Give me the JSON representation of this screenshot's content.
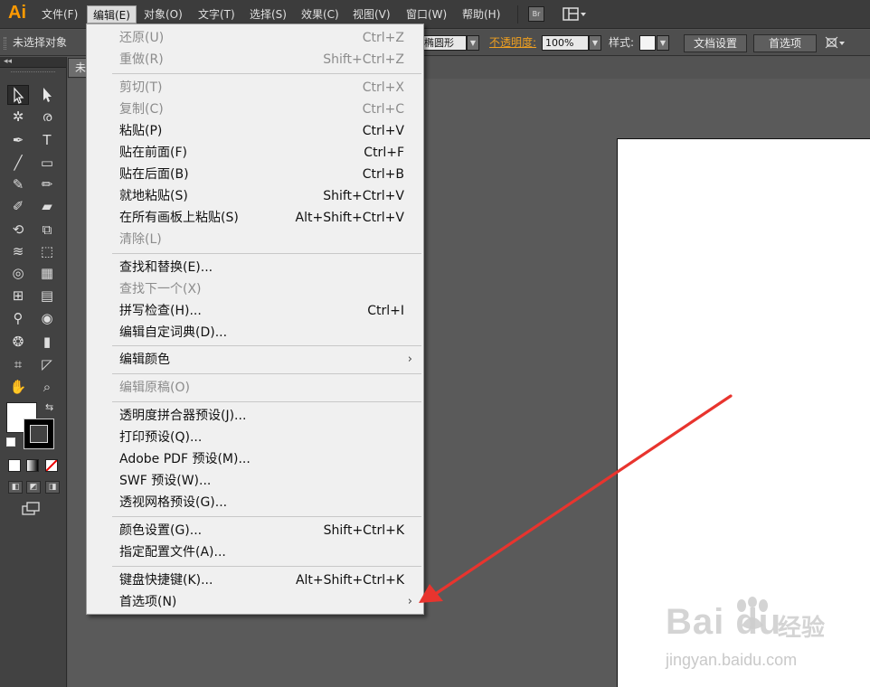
{
  "app": {
    "logo": "Ai",
    "accent": "#ff9a00"
  },
  "menubar": {
    "items": [
      "文件(F)",
      "编辑(E)",
      "对象(O)",
      "文字(T)",
      "选择(S)",
      "效果(C)",
      "视图(V)",
      "窗口(W)",
      "帮助(H)"
    ],
    "active": "编辑(E)",
    "bridge_label": "Br"
  },
  "controlbar": {
    "selection_status": "未选择对象",
    "shape_field": "椭圆形",
    "opacity_label": "不透明度:",
    "opacity_value": "100%",
    "style_label": "样式:",
    "doc_setup_button": "文档设置",
    "preferences_button": "首选项",
    "opacity_color": "#f0a020"
  },
  "document_tab": {
    "label": "未"
  },
  "tools_panel": {
    "collapse_glyph": "◂◂"
  },
  "edit_menu": {
    "items": [
      {
        "label": "还原(U)",
        "shortcut": "Ctrl+Z",
        "disabled": true
      },
      {
        "label": "重做(R)",
        "shortcut": "Shift+Ctrl+Z",
        "disabled": true
      },
      {
        "label": "剪切(T)",
        "shortcut": "Ctrl+X",
        "disabled": true
      },
      {
        "label": "复制(C)",
        "shortcut": "Ctrl+C",
        "disabled": true
      },
      {
        "label": "粘贴(P)",
        "shortcut": "Ctrl+V",
        "disabled": false
      },
      {
        "label": "贴在前面(F)",
        "shortcut": "Ctrl+F",
        "disabled": false
      },
      {
        "label": "贴在后面(B)",
        "shortcut": "Ctrl+B",
        "disabled": false
      },
      {
        "label": "就地粘贴(S)",
        "shortcut": "Shift+Ctrl+V",
        "disabled": false
      },
      {
        "label": "在所有画板上粘贴(S)",
        "shortcut": "Alt+Shift+Ctrl+V",
        "disabled": false
      },
      {
        "label": "清除(L)",
        "shortcut": "",
        "disabled": true
      },
      {
        "label": "查找和替换(E)...",
        "shortcut": "",
        "disabled": false
      },
      {
        "label": "查找下一个(X)",
        "shortcut": "",
        "disabled": true
      },
      {
        "label": "拼写检查(H)...",
        "shortcut": "Ctrl+I",
        "disabled": false
      },
      {
        "label": "编辑自定词典(D)...",
        "shortcut": "",
        "disabled": false
      },
      {
        "label": "编辑颜色",
        "shortcut": "",
        "disabled": false,
        "submenu": true
      },
      {
        "label": "编辑原稿(O)",
        "shortcut": "",
        "disabled": true
      },
      {
        "label": "透明度拼合器预设(J)...",
        "shortcut": "",
        "disabled": false
      },
      {
        "label": "打印预设(Q)...",
        "shortcut": "",
        "disabled": false
      },
      {
        "label": "Adobe PDF 预设(M)...",
        "shortcut": "",
        "disabled": false
      },
      {
        "label": "SWF 预设(W)...",
        "shortcut": "",
        "disabled": false
      },
      {
        "label": "透视网格预设(G)...",
        "shortcut": "",
        "disabled": false
      },
      {
        "label": "颜色设置(G)...",
        "shortcut": "Shift+Ctrl+K",
        "disabled": false
      },
      {
        "label": "指定配置文件(A)...",
        "shortcut": "",
        "disabled": false
      },
      {
        "label": "键盘快捷键(K)...",
        "shortcut": "Alt+Shift+Ctrl+K",
        "disabled": false
      },
      {
        "label": "首选项(N)",
        "shortcut": "",
        "disabled": false,
        "submenu": true
      }
    ],
    "submenu_glyph": "›"
  },
  "annotation": {
    "arrow_color": "#e8342e"
  },
  "watermark": {
    "brand": "Bai du",
    "brand_cn": "经验",
    "url": "jingyan.baidu.com"
  }
}
